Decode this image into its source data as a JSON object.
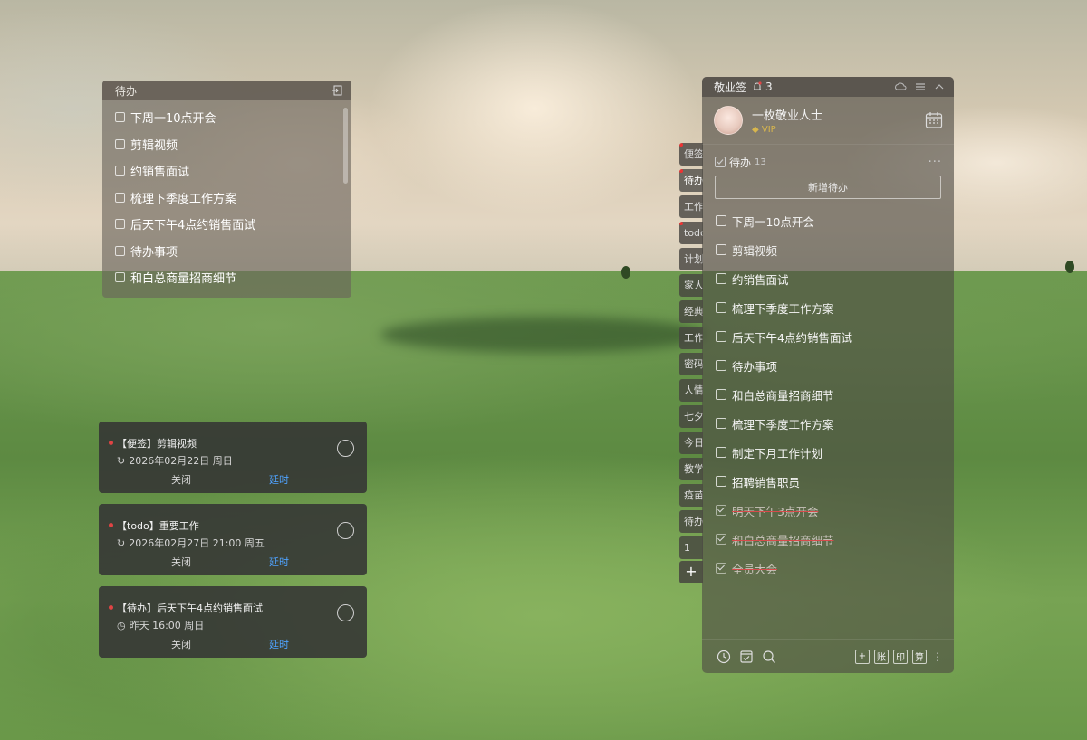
{
  "left_todo": {
    "title": "待办",
    "items": [
      "下周一10点开会",
      "剪辑视频",
      "约销售面试",
      "梳理下季度工作方案",
      "后天下午4点约销售面试",
      "待办事项",
      "和白总商量招商细节"
    ]
  },
  "reminders": [
    {
      "title": "【便签】剪辑视频",
      "time": "2026年02月22日 周日",
      "close": "关闭",
      "delay": "延时"
    },
    {
      "title": "【todo】重要工作",
      "time": "2026年02月27日 21:00 周五",
      "close": "关闭",
      "delay": "延时"
    },
    {
      "title": "【待办】后天下午4点约销售面试",
      "time": "昨天 16:00 周日",
      "close": "关闭",
      "delay": "延时"
    }
  ],
  "side_tabs": [
    "便签",
    "待办",
    "工作",
    "todo",
    "计划",
    "家人",
    "经典",
    "工作",
    "密码",
    "人情",
    "七夕",
    "今日",
    "教学",
    "疫苗",
    "待办",
    "1"
  ],
  "main": {
    "app_name": "敬业签",
    "notification_count": "3",
    "user_name": "一枚敬业人士",
    "vip_label": "VIP",
    "section_title": "待办",
    "section_count": "13",
    "add_button": "新增待办",
    "items": [
      {
        "label": "下周一10点开会",
        "done": false
      },
      {
        "label": "剪辑视频",
        "done": false
      },
      {
        "label": "约销售面试",
        "done": false
      },
      {
        "label": "梳理下季度工作方案",
        "done": false
      },
      {
        "label": "后天下午4点约销售面试",
        "done": false
      },
      {
        "label": "待办事项",
        "done": false
      },
      {
        "label": "和白总商量招商细节",
        "done": false
      },
      {
        "label": "梳理下季度工作方案",
        "done": false
      },
      {
        "label": "制定下月工作计划",
        "done": false
      },
      {
        "label": "招聘销售职员",
        "done": false
      },
      {
        "label": "明天下午3点开会",
        "done": true
      },
      {
        "label": "和白总商量招商细节",
        "done": true
      },
      {
        "label": "全员大会",
        "done": true
      }
    ],
    "bottom_buttons": [
      "+",
      "账",
      "印",
      "算"
    ]
  },
  "colors": {
    "accent_blue": "#4fa3ff",
    "red_mark": "#e04444",
    "vip_gold": "#d8b64d"
  }
}
